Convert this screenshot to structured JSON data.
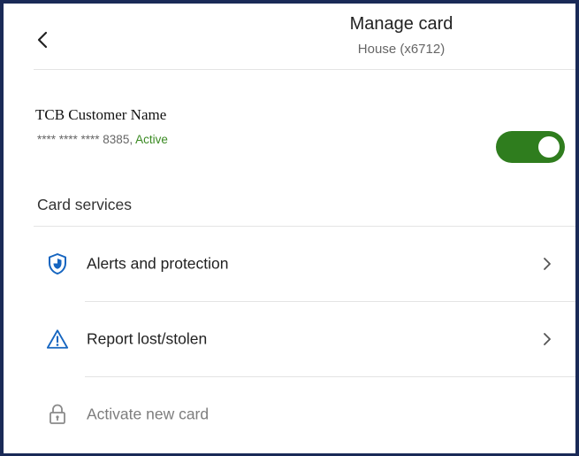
{
  "header": {
    "title": "Manage card",
    "subtitle": "House (x6712)"
  },
  "card": {
    "customer_name": "TCB Customer Name",
    "masked_number": "**** **** **** 8385, ",
    "status": "Active",
    "toggle_on": true
  },
  "services": {
    "title": "Card services",
    "items": [
      {
        "label": "Alerts and protection",
        "icon": "shield-icon",
        "enabled": true
      },
      {
        "label": "Report lost/stolen",
        "icon": "warning-icon",
        "enabled": true
      },
      {
        "label": "Activate new card",
        "icon": "lock-icon",
        "enabled": false
      }
    ]
  },
  "colors": {
    "accent_blue": "#1565c0",
    "toggle_green": "#2f7d1e",
    "status_green": "#3a8a22",
    "frame_navy": "#1a2a57"
  }
}
